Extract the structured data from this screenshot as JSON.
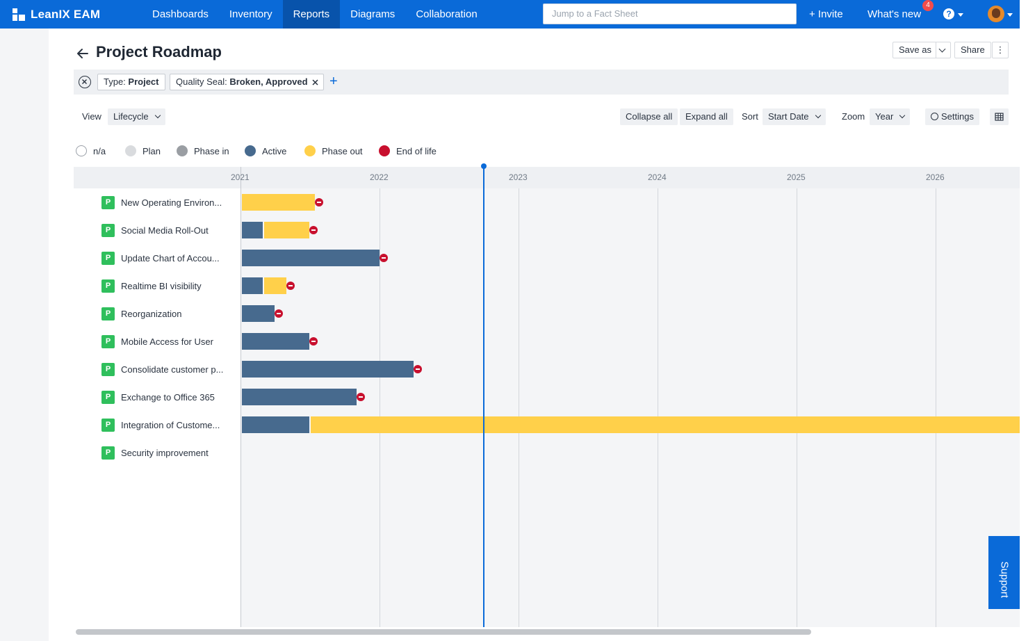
{
  "brand": {
    "name": "LeanIX EAM"
  },
  "nav": [
    {
      "label": "Dashboards",
      "active": false
    },
    {
      "label": "Inventory",
      "active": false
    },
    {
      "label": "Reports",
      "active": true
    },
    {
      "label": "Diagrams",
      "active": false
    },
    {
      "label": "Collaboration",
      "active": false
    }
  ],
  "search": {
    "placeholder": "Jump to a Fact Sheet"
  },
  "topbar": {
    "invite_label": "+ Invite",
    "whats_new_label": "What's new",
    "whats_new_count": "4",
    "help_label": "?"
  },
  "page": {
    "title": "Project Roadmap"
  },
  "actions": {
    "save_as": "Save as",
    "share": "Share",
    "more": "⋮"
  },
  "filters": {
    "chips": [
      {
        "key": "Type:",
        "value": "Project"
      },
      {
        "key": "Quality Seal:",
        "value": "Broken, Approved",
        "removable": true
      }
    ],
    "add": "+"
  },
  "toolbar": {
    "view_label": "View",
    "view_value": "Lifecycle",
    "collapse_all": "Collapse all",
    "expand_all": "Expand all",
    "sort_label": "Sort",
    "sort_value": "Start Date",
    "zoom_label": "Zoom",
    "zoom_value": "Year",
    "settings": "Settings"
  },
  "legend": [
    {
      "label": "n/a",
      "color": "#ffffff"
    },
    {
      "label": "Plan",
      "color": "#d9dbde"
    },
    {
      "label": "Phase in",
      "color": "#9a9ea3"
    },
    {
      "label": "Active",
      "color": "#476a8e"
    },
    {
      "label": "Phase out",
      "color": "#ffd04a"
    },
    {
      "label": "End of life",
      "color": "#c8102e"
    }
  ],
  "timeline": {
    "years": [
      "2021",
      "2022",
      "2023",
      "2024",
      "2025",
      "2026"
    ],
    "today": "2022-10-01"
  },
  "rows": [
    {
      "badge": "P",
      "name": "New Operating Environ...",
      "segments": [
        {
          "phase": "Phase out",
          "start": "2021-01-01",
          "end": "2021-07-15"
        }
      ],
      "end_of_life": "2021-07-15"
    },
    {
      "badge": "P",
      "name": "Social Media Roll-Out",
      "segments": [
        {
          "phase": "Active",
          "start": "2021-01-01",
          "end": "2021-03-01"
        },
        {
          "phase": "Phase out",
          "start": "2021-03-01",
          "end": "2021-06-30"
        }
      ],
      "end_of_life": "2021-06-30"
    },
    {
      "badge": "P",
      "name": "Update Chart of Accou...",
      "segments": [
        {
          "phase": "Active",
          "start": "2021-01-01",
          "end": "2022-01-01"
        }
      ],
      "end_of_life": "2022-01-01"
    },
    {
      "badge": "P",
      "name": "Realtime BI visibility",
      "segments": [
        {
          "phase": "Active",
          "start": "2021-01-01",
          "end": "2021-03-01"
        },
        {
          "phase": "Phase out",
          "start": "2021-03-01",
          "end": "2021-05-01"
        }
      ],
      "end_of_life": "2021-05-01"
    },
    {
      "badge": "P",
      "name": "Reorganization",
      "segments": [
        {
          "phase": "Active",
          "start": "2021-01-01",
          "end": "2021-04-01"
        }
      ],
      "end_of_life": "2021-04-01"
    },
    {
      "badge": "P",
      "name": "Mobile Access for User",
      "segments": [
        {
          "phase": "Active",
          "start": "2021-01-01",
          "end": "2021-06-30"
        }
      ],
      "end_of_life": "2021-06-30"
    },
    {
      "badge": "P",
      "name": "Consolidate customer p...",
      "segments": [
        {
          "phase": "Active",
          "start": "2021-01-01",
          "end": "2022-04-01"
        }
      ],
      "end_of_life": "2022-04-01"
    },
    {
      "badge": "P",
      "name": "Exchange to Office 365",
      "segments": [
        {
          "phase": "Active",
          "start": "2021-01-01",
          "end": "2021-11-01"
        }
      ],
      "end_of_life": "2021-11-01"
    },
    {
      "badge": "P",
      "name": "Integration of Custome...",
      "segments": [
        {
          "phase": "Active",
          "start": "2021-01-01",
          "end": "2021-06-30"
        },
        {
          "phase": "Phase out",
          "start": "2021-06-30",
          "end": "2026-12-31"
        }
      ],
      "end_of_life": null
    },
    {
      "badge": "P",
      "name": "Security improvement",
      "segments": [],
      "end_of_life": null
    }
  ],
  "support": {
    "label": "Support"
  }
}
